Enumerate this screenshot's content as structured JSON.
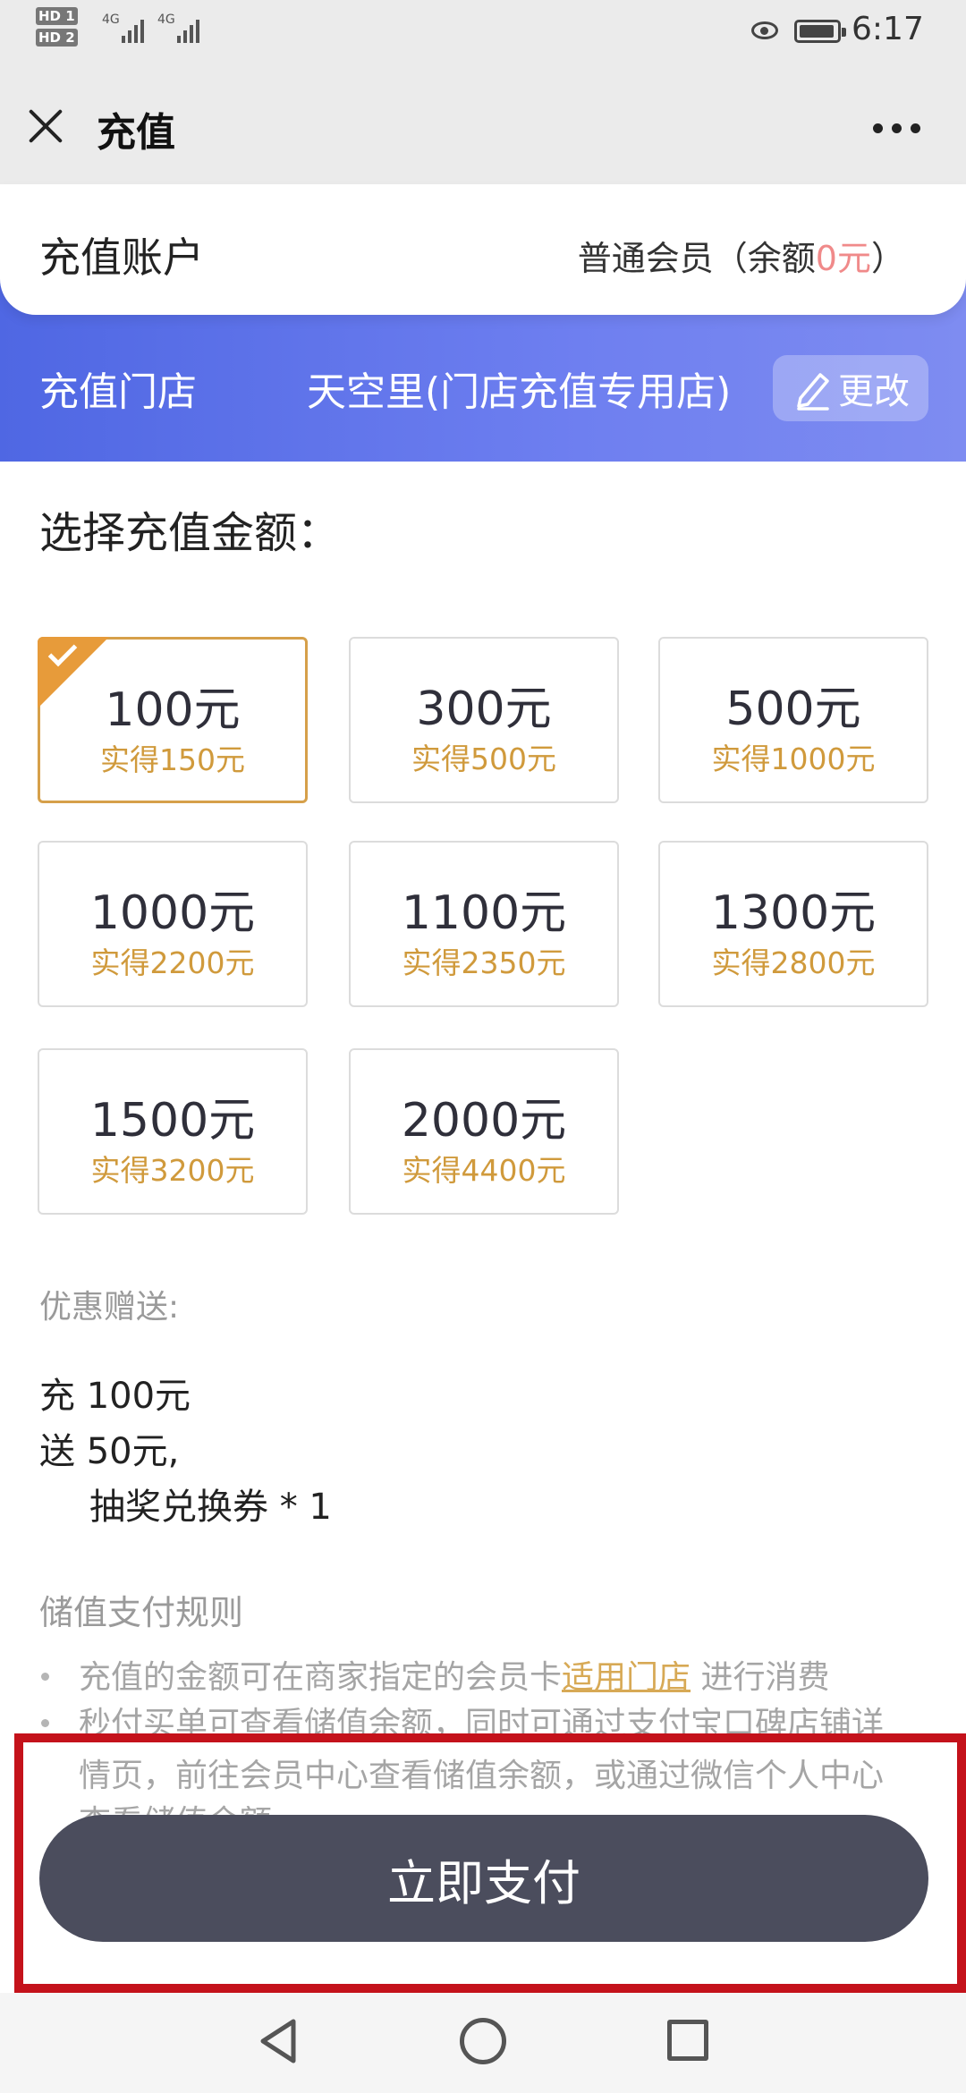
{
  "status_bar": {
    "hd1": "HD 1",
    "hd2": "HD 2",
    "net1": "4G",
    "net2": "4G",
    "time": "6:17",
    "icons": [
      "signal-icon",
      "eye-icon",
      "battery-icon"
    ]
  },
  "nav": {
    "title": "充值",
    "close_icon": "close-icon",
    "more_icon": "more-icon"
  },
  "account": {
    "label": "充值账户",
    "level_prefix": "普通会员（余额",
    "balance": "0元",
    "level_suffix": "）",
    "balance_color": "#f08a8a"
  },
  "store": {
    "label": "充值门店",
    "name": "天空里(门店充值专用店)",
    "change_label": "更改",
    "banner_color": "#5a6ee8"
  },
  "amounts": {
    "title": "选择充值金额：",
    "accent_color": "#d09a3c",
    "selected_index": 0,
    "options": [
      {
        "amount": "100元",
        "bonus": "实得150元"
      },
      {
        "amount": "300元",
        "bonus": "实得500元"
      },
      {
        "amount": "500元",
        "bonus": "实得1000元"
      },
      {
        "amount": "1000元",
        "bonus": "实得2200元"
      },
      {
        "amount": "1100元",
        "bonus": "实得2350元"
      },
      {
        "amount": "1300元",
        "bonus": "实得2800元"
      },
      {
        "amount": "1500元",
        "bonus": "实得3200元"
      },
      {
        "amount": "2000元",
        "bonus": "实得4400元"
      }
    ]
  },
  "promo": {
    "title": "优惠赠送:",
    "lines": [
      "充 100元",
      "送 50元,",
      "抽奖兑换券 * 1"
    ]
  },
  "rules": {
    "title": "储值支付规则",
    "rule1_prefix": "充值的金额可在商家指定的会员卡",
    "rule1_link": "适用门店",
    "rule1_suffix": " 进行消费",
    "rule2_line1": "秒付买单可查看储值余额，同时可通过支付宝口碑店铺详",
    "rule2_line2": "情页，前往会员中心查看储值余额，或通过微信个人中心",
    "rule2_line3": "查看储值余额"
  },
  "pay": {
    "button_label": "立即支付",
    "button_color": "#4b4d5d",
    "highlight_color": "#c4121b"
  },
  "system_nav": {
    "icons": [
      "back-icon",
      "home-icon",
      "recent-apps-icon"
    ]
  }
}
